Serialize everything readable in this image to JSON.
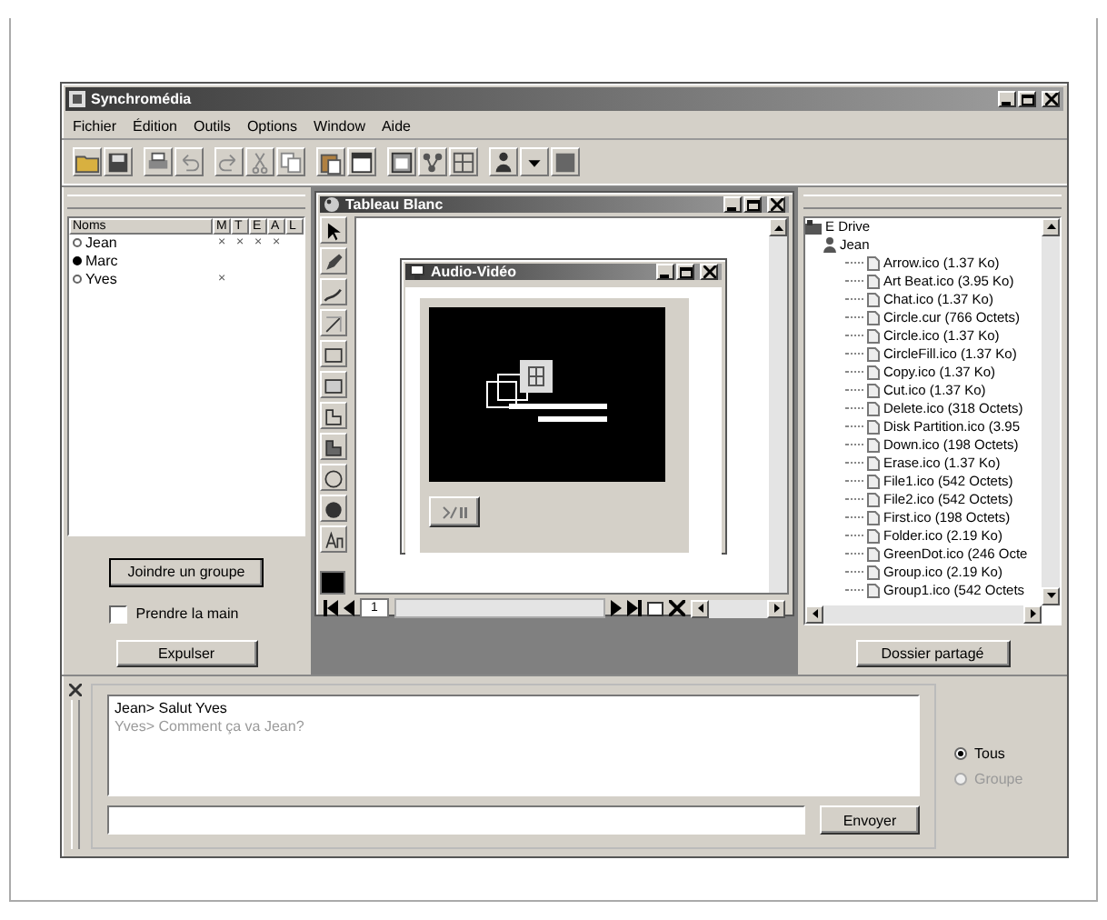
{
  "window": {
    "title": "Synchromédia"
  },
  "menu": [
    "Fichier",
    "Édition",
    "Outils",
    "Options",
    "Window",
    "Aide"
  ],
  "participants": {
    "columns": [
      "Noms",
      "M",
      "T",
      "E",
      "A",
      "L"
    ],
    "rows": [
      {
        "name": "Jean",
        "selected": false,
        "marks": [
          "×",
          "×",
          "×",
          "×"
        ]
      },
      {
        "name": "Marc",
        "selected": true
      },
      {
        "name": "Yves",
        "selected": false,
        "marks": [
          "×"
        ]
      }
    ]
  },
  "join_button": "Joindre un groupe",
  "take_control": {
    "label": "Prendre la main",
    "checked": false
  },
  "expel_button": "Expulser",
  "whiteboard": {
    "title": "Tableau Blanc",
    "page": "1"
  },
  "video_window": {
    "title": "Audio-Vidéo"
  },
  "files": {
    "root": "E Drive",
    "user": "Jean",
    "items": [
      "Arrow.ico (1.37 Ko)",
      "Art Beat.ico (3.95 Ko)",
      "Chat.ico (1.37 Ko)",
      "Circle.cur (766 Octets)",
      "Circle.ico (1.37 Ko)",
      "CircleFill.ico (1.37 Ko)",
      "Copy.ico (1.37 Ko)",
      "Cut.ico (1.37 Ko)",
      "Delete.ico (318 Octets)",
      "Disk Partition.ico (3.95",
      "Down.ico (198 Octets)",
      "Erase.ico (1.37 Ko)",
      "File1.ico (542 Octets)",
      "File2.ico (542 Octets)",
      "First.ico (198 Octets)",
      "Folder.ico (2.19 Ko)",
      "GreenDot.ico (246 Octe",
      "Group.ico (2.19 Ko)",
      "Group1.ico (542 Octets"
    ]
  },
  "shared_folder_button": "Dossier partagé",
  "chat": {
    "messages": [
      {
        "text": "Jean> Salut Yves",
        "color": "#000000"
      },
      {
        "text": "Yves> Comment ça va Jean?",
        "color": "#9a9a9a"
      }
    ],
    "send_button": "Envoyer",
    "recipients": [
      {
        "label": "Tous",
        "selected": true,
        "disabled": false
      },
      {
        "label": "Groupe",
        "selected": false,
        "disabled": true
      }
    ]
  }
}
